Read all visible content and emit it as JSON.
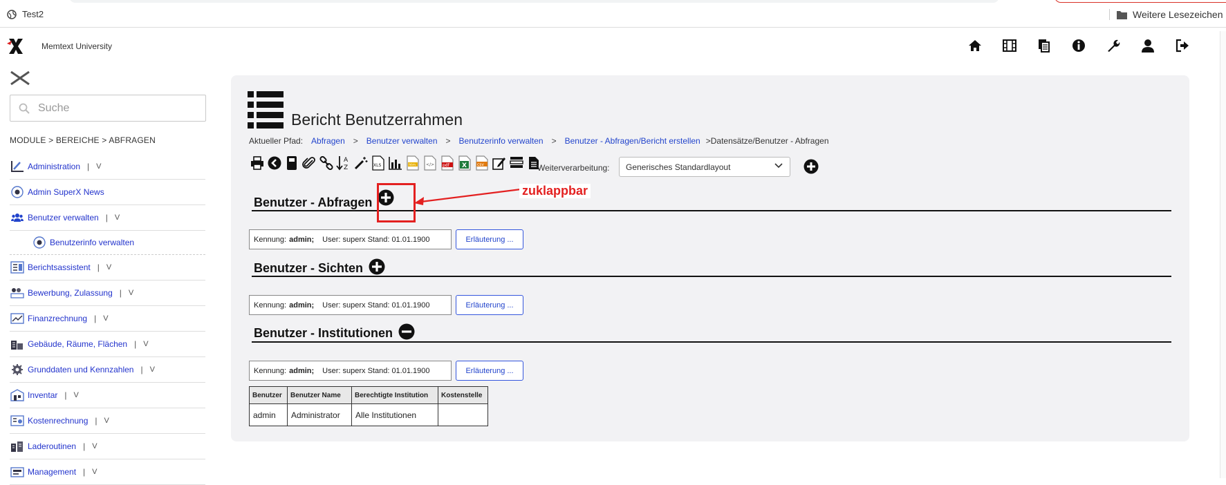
{
  "browser": {
    "tab_title": "Test2",
    "bookmarks_folder": "Weitere Lesezeichen"
  },
  "header": {
    "university": "Memtext University",
    "icons": [
      "home-icon",
      "film-icon",
      "copy-icon",
      "info-icon",
      "wrench-icon",
      "user-icon",
      "logout-icon"
    ]
  },
  "sidebar": {
    "search_placeholder": "Suche",
    "breadcrumb": "MODULE > BEREICHE > ABFRAGEN",
    "pipe": "|",
    "expand": "V",
    "items": [
      {
        "label": "Administration",
        "icon": "admin-icon",
        "expandable": true
      },
      {
        "label": "Admin SuperX News",
        "icon": "radio-dot-icon",
        "expandable": false
      },
      {
        "label": "Benutzer verwalten",
        "icon": "users-icon",
        "expandable": true
      },
      {
        "label": "Benutzerinfo verwalten",
        "icon": "radio-dot-icon",
        "expandable": false,
        "sub": true
      },
      {
        "label": "Berichtsassistent",
        "icon": "report-assistant-icon",
        "expandable": true
      },
      {
        "label": "Bewerbung, Zulassung",
        "icon": "application-icon",
        "expandable": true
      },
      {
        "label": "Finanzrechnung",
        "icon": "finance-icon",
        "expandable": true
      },
      {
        "label": "Gebäude, Räume, Flächen",
        "icon": "building-icon",
        "expandable": true
      },
      {
        "label": "Grunddaten und Kennzahlen",
        "icon": "gear-data-icon",
        "expandable": true
      },
      {
        "label": "Inventar",
        "icon": "inventory-icon",
        "expandable": true
      },
      {
        "label": "Kostenrechnung",
        "icon": "cost-icon",
        "expandable": true
      },
      {
        "label": "Laderoutinen",
        "icon": "load-icon",
        "expandable": true
      },
      {
        "label": "Management",
        "icon": "management-icon",
        "expandable": true
      }
    ]
  },
  "main": {
    "title": "Bericht Benutzerrahmen",
    "path_label": "Aktueller Pfad:",
    "path_links": [
      "Abfragen",
      "Benutzer verwalten",
      "Benutzerinfo verwalten",
      "Benutzer - Abfragen/Bericht erstellen"
    ],
    "path_sep": ">",
    "path_current": ">Datensätze/Benutzer - Abfragen",
    "toolbar_icons": [
      "print-icon",
      "back-icon",
      "save-icon",
      "attach-icon",
      "link-icon",
      "sort-az-icon",
      "wand-icon",
      "xls-icon",
      "chart-icon",
      "html-file-icon",
      "xml-file-icon",
      "pdf-file-icon",
      "excel-file-icon",
      "csv-file-icon",
      "edit-icon",
      "list-icon",
      "document-icon"
    ],
    "weiterverarbeitung_label": "Weiterverarbeitung:",
    "weiterverarbeitung_value": "Generisches Standardlayout",
    "sections": [
      {
        "title": "Benutzer - Abfragen",
        "toggle": "plus"
      },
      {
        "title": "Benutzer - Sichten",
        "toggle": "plus"
      },
      {
        "title": "Benutzer - Institutionen",
        "toggle": "minus"
      }
    ],
    "info": {
      "kennung_label": "Kennung:",
      "kennung_value": "admin;",
      "user_text": "User: superx Stand: 01.01.1900",
      "button": "Erläuterung ..."
    },
    "table": {
      "headers": [
        "Benutzer",
        "Benutzer Name",
        "Berechtigte Institution",
        "Kostenstelle"
      ],
      "rows": [
        [
          "admin",
          "Administrator",
          "Alle Institutionen",
          ""
        ]
      ]
    },
    "annotation": "zuklappbar"
  }
}
